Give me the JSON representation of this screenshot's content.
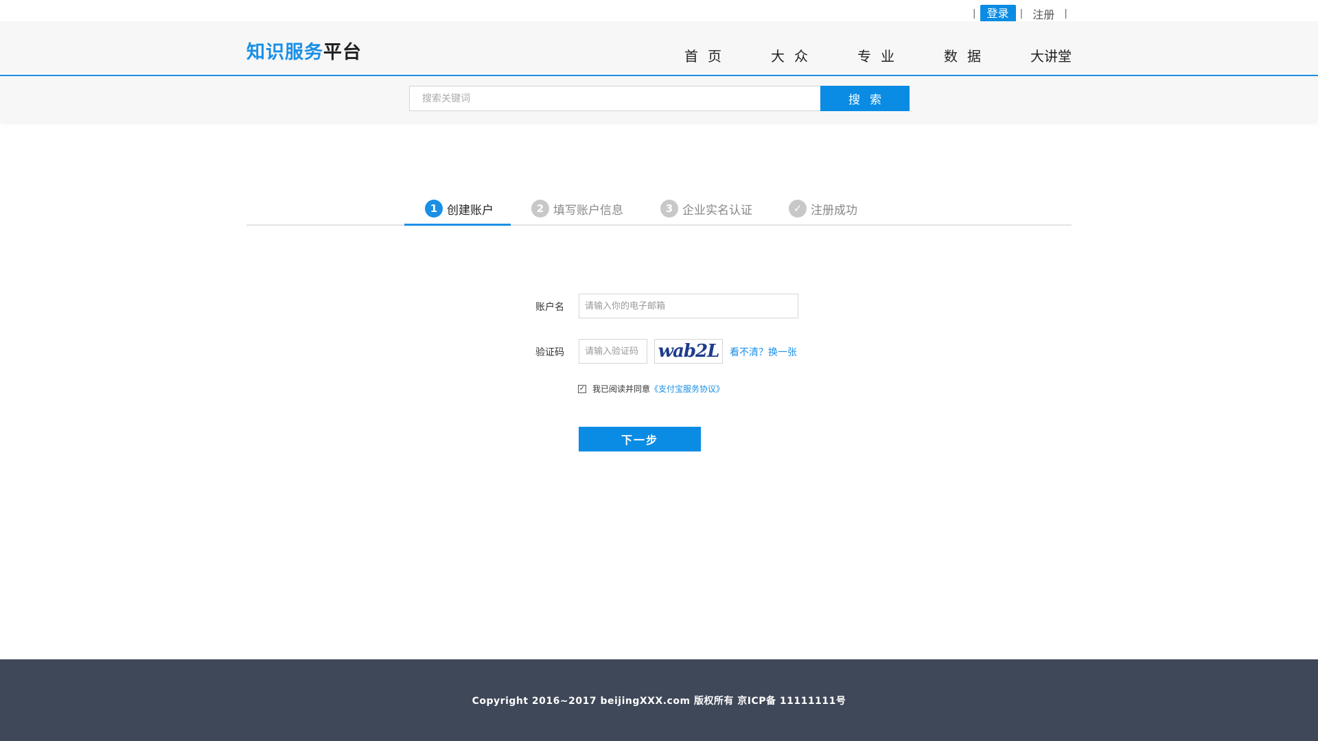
{
  "topbar": {
    "separator": "|",
    "login_label": "登录",
    "register_label": "注册"
  },
  "header": {
    "logo_blue": "知识服务",
    "logo_dark": "平台",
    "nav": [
      "首页",
      "大众",
      "专业",
      "数据",
      "大讲堂"
    ]
  },
  "search": {
    "placeholder": "搜索关键词",
    "button_label": "搜索"
  },
  "steps": [
    {
      "num": "1",
      "label": "创建账户",
      "active": true
    },
    {
      "num": "2",
      "label": "填写账户信息",
      "active": false
    },
    {
      "num": "3",
      "label": "企业实名认证",
      "active": false
    },
    {
      "num": "✓",
      "label": "注册成功",
      "active": false
    }
  ],
  "form": {
    "account_label": "账户名",
    "account_placeholder": "请输入你的电子邮箱",
    "captcha_label": "验证码",
    "captcha_placeholder": "请输入验证码",
    "captcha_text": "wab2L",
    "refresh_link": "看不清？换一张",
    "agree_text": "我已阅读并同意",
    "agree_link": "《支付宝服务协议》",
    "agree_checked": true,
    "next_label": "下一步"
  },
  "footer": {
    "copyright": "Copyright 2016~2017 beijingXXX.com 版权所有 京ICP备 11111111号"
  },
  "colors": {
    "accent": "#0a8ce4",
    "footer_bg": "#3f4858",
    "header_bg": "#f7f7f7"
  }
}
